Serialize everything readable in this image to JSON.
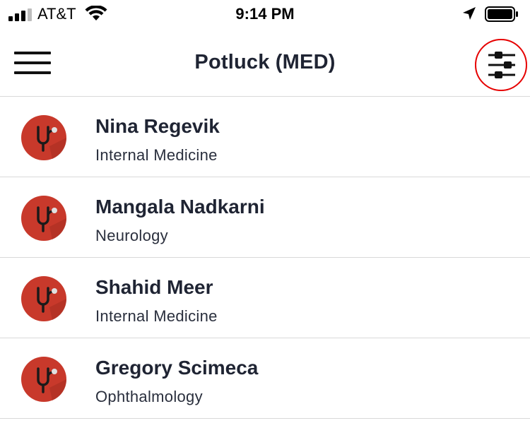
{
  "status_bar": {
    "carrier": "AT&T",
    "time": "9:14 PM",
    "icons": [
      "signal-icon",
      "wifi-icon",
      "location-arrow-icon",
      "battery-icon"
    ]
  },
  "header": {
    "title": "Potluck (MED)",
    "menu_icon": "hamburger-menu-icon",
    "filter_icon": "sliders-filter-icon",
    "filter_highlight_color": "#e60000"
  },
  "contacts": [
    {
      "name": "Nina Regevik",
      "specialty": "Internal Medicine",
      "avatar_icon": "stethoscope-icon"
    },
    {
      "name": "Mangala Nadkarni",
      "specialty": "Neurology",
      "avatar_icon": "stethoscope-icon"
    },
    {
      "name": "Shahid Meer",
      "specialty": "Internal Medicine",
      "avatar_icon": "stethoscope-icon"
    },
    {
      "name": "Gregory Scimeca",
      "specialty": "Ophthalmology",
      "avatar_icon": "stethoscope-icon"
    }
  ],
  "colors": {
    "avatar_bg": "#c8392b",
    "avatar_shadow": "#a82e22",
    "text_primary": "#1f2433",
    "divider": "#d9d9d9"
  }
}
